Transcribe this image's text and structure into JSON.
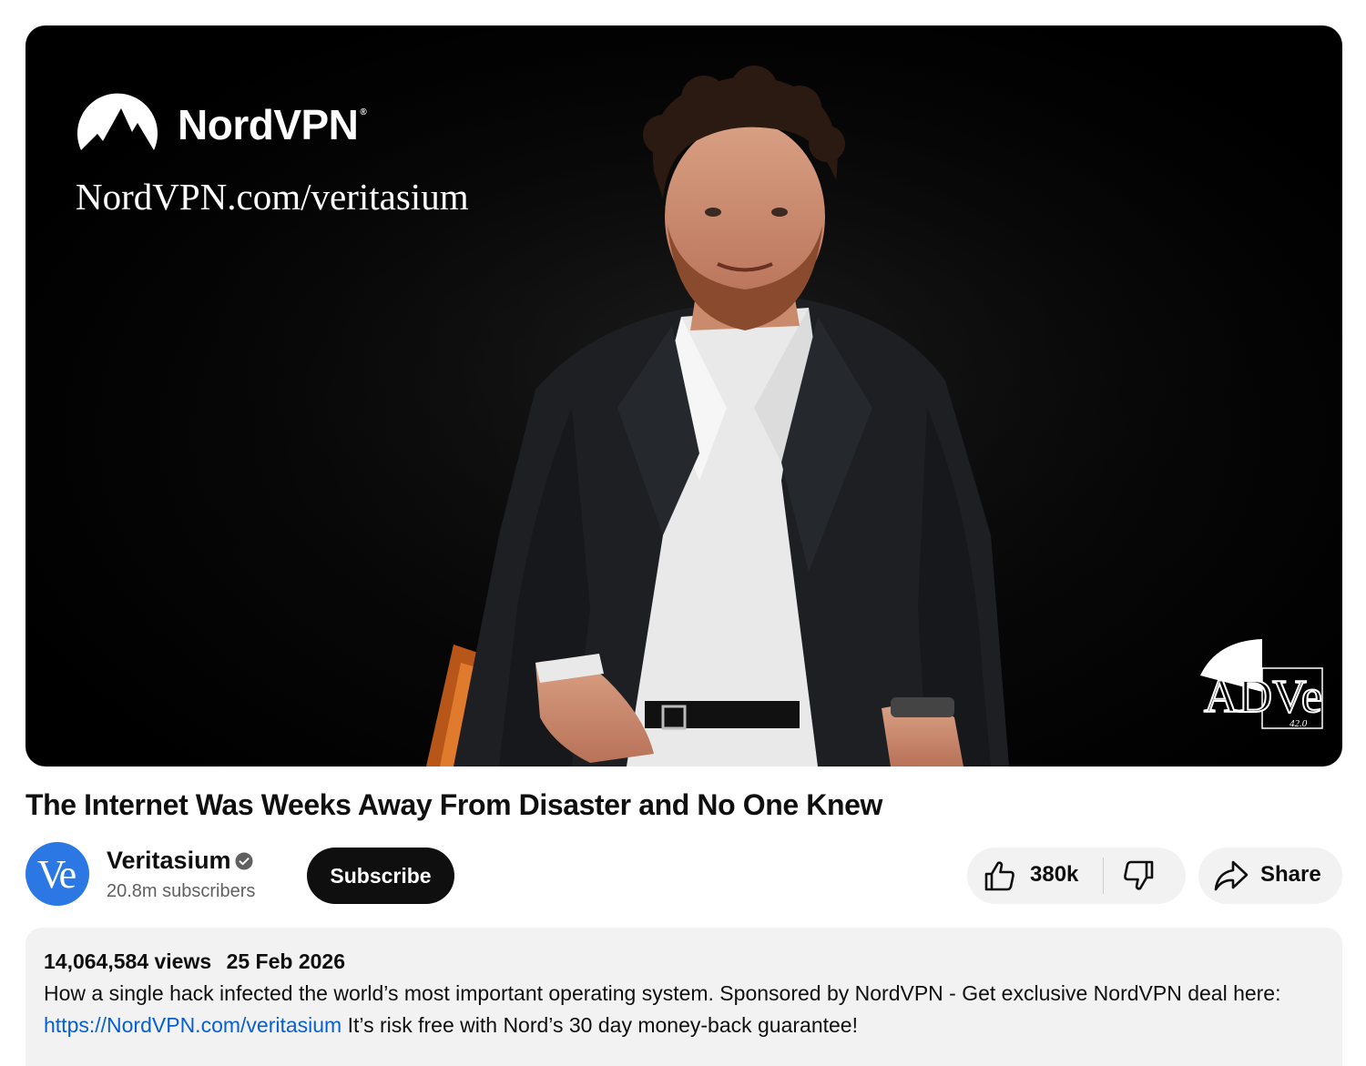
{
  "video": {
    "sponsor_brand": "NordVPN",
    "sponsor_trademark": "®",
    "sponsor_url": "NordVPN.com/veritasium",
    "watermark_letters": "ADVe",
    "watermark_number": "42.0",
    "title": "The Internet Was Weeks Away From Disaster and No One Knew"
  },
  "channel": {
    "avatar_text": "Ve",
    "name": "Veritasium",
    "verified_icon": "verified-check-icon",
    "subscribers": "20.8m subscribers",
    "subscribe_label": "Subscribe"
  },
  "actions": {
    "like_icon": "thumbs-up-icon",
    "like_count": "380k",
    "dislike_icon": "thumbs-down-icon",
    "share_icon": "share-arrow-icon",
    "share_label": "Share"
  },
  "description": {
    "views": "14,064,584 views",
    "date": "25 Feb 2026",
    "text_before_link": "How a single hack infected the world’s most important operating system. Sponsored by NordVPN - Get exclusive NordVPN deal here: ",
    "link": "https://NordVPN.com/veritasium",
    "text_after_link": " It’s risk free with Nord’s 30 day money-back guarantee!"
  },
  "colors": {
    "accent_link": "#065fd4",
    "avatar_bg": "#2b78e4",
    "subscribe_bg": "#0f0f0f",
    "chip_bg": "#f2f2f2"
  }
}
